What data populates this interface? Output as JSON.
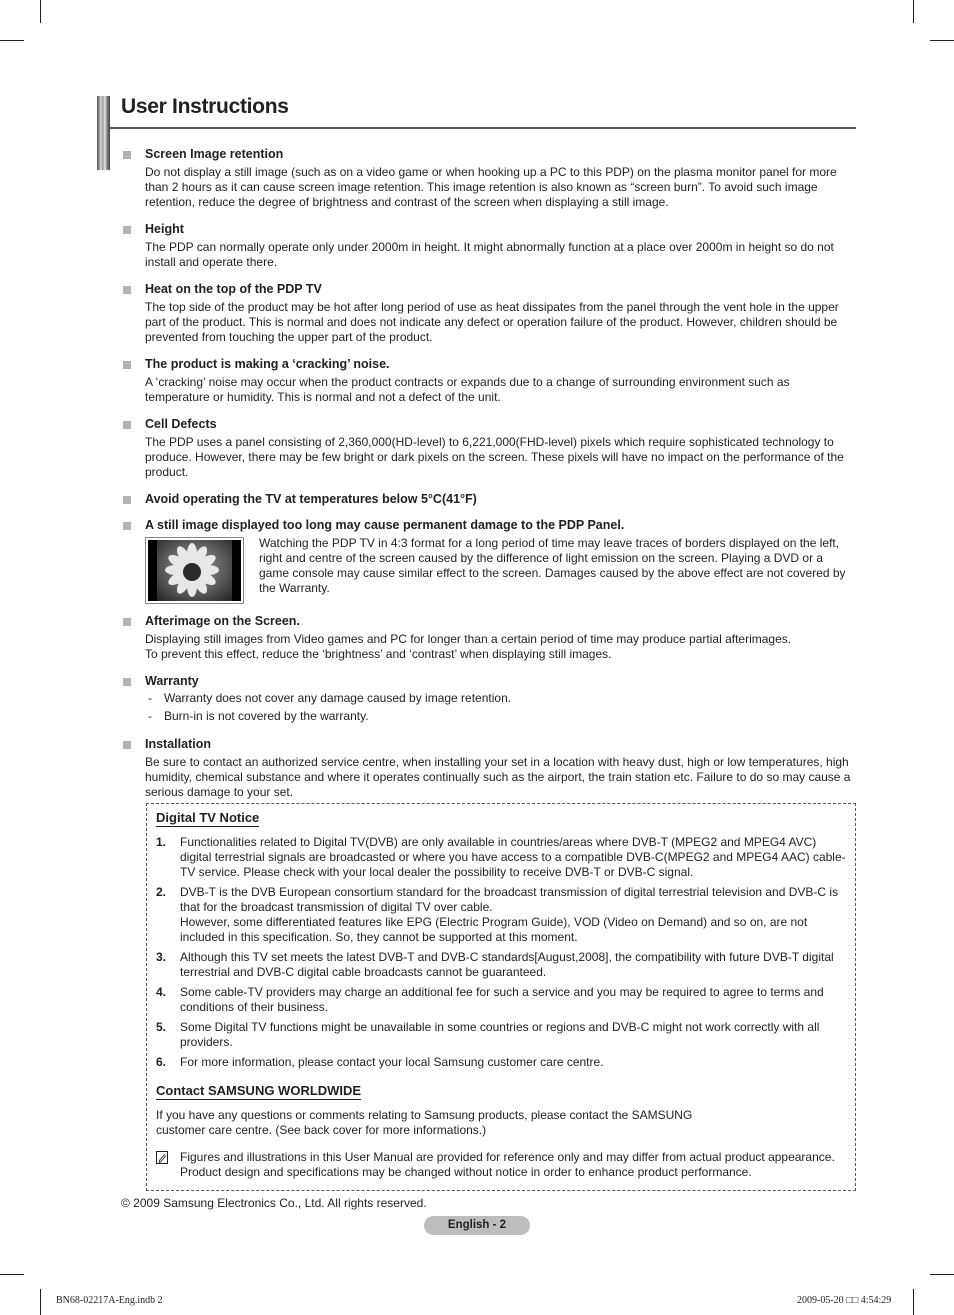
{
  "header": {
    "title": "User Instructions"
  },
  "sections": [
    {
      "title": "Screen Image retention",
      "body": "Do not display a still image (such as on a video game or when hooking up a PC to this PDP) on the plasma monitor panel for more than 2 hours as it can cause screen image retention. This image retention is also known as “screen burn”. To avoid such image retention, reduce the degree of brightness and contrast of the screen when displaying a still image."
    },
    {
      "title": "Height",
      "body": "The PDP can normally operate only under 2000m in height. It might abnormally function at a place over 2000m in height so do not install and operate there."
    },
    {
      "title": "Heat on the top of the PDP TV",
      "body": "The top side of the product may be hot after long period of use as heat dissipates from the panel through the vent hole in the upper part of the product. This is normal and does not indicate any defect or operation failure of the product. However, children should be prevented from touching the upper part of the product."
    },
    {
      "title": "The product is making a ‘cracking’ noise.",
      "body": "A ‘cracking’ noise may occur when the product contracts or expands due to a change of surrounding environment such as temperature or humidity. This is normal and not a defect of the unit."
    },
    {
      "title": "Cell Defects",
      "body": "The PDP uses a panel consisting of 2,360,000(HD-level) to 6,221,000(FHD-level) pixels which require sophisticated technology to produce. However, there may be few bright or dark pixels on the screen. These pixels will have no impact on the performance of the product."
    },
    {
      "title": "Avoid operating the TV at temperatures below 5°C(41°F)"
    },
    {
      "title": "A still image displayed too long may cause permanent damage to the PDP Panel.",
      "image_alt": "sunflower-image-with-side-borders",
      "body": "Watching the PDP TV in 4:3 format for a long period of time may leave traces of borders displayed on the left, right and centre of the screen caused by the difference of light emission on the screen. Playing a DVD or a game console may cause similar effect to the screen. Damages caused by the above effect are not covered by the Warranty."
    },
    {
      "title": "Afterimage on the Screen.",
      "body_lines": [
        "Displaying still images from Video games and PC for longer than a certain period of time may produce partial afterimages.",
        "To prevent this effect, reduce the ‘brightness’ and ‘contrast’ when displaying still images."
      ]
    },
    {
      "title": "Warranty",
      "items": [
        "Warranty does not cover any damage caused by image retention.",
        "Burn-in is not covered by the warranty."
      ]
    },
    {
      "title": "Installation",
      "body": "Be sure to contact an authorized service centre, when installing your set in a location with heavy dust, high or low temperatures, high humidity, chemical substance and where it operates continually such as the airport, the train station etc. Failure to do so may cause a serious damage to your set."
    }
  ],
  "notice": {
    "title": "Digital TV Notice",
    "items": [
      {
        "num": "1.",
        "text": "Functionalities related to Digital TV(DVB) are only available in countries/areas where DVB-T (MPEG2 and MPEG4 AVC) digital terrestrial signals are broadcasted or where you have access to a compatible DVB-C(MPEG2 and MPEG4 AAC) cable-TV service. Please check with your local dealer the possibility to receive DVB-T or DVB-C signal."
      },
      {
        "num": "2.",
        "text": "DVB-T is the DVB European consortium standard for the broadcast transmission of digital terrestrial television and DVB-C is that for the broadcast transmission of digital TV over cable.",
        "text2": "However, some differentiated features like EPG (Electric Program Guide), VOD (Video on Demand) and so on, are not included in this specification. So, they cannot be supported at this moment."
      },
      {
        "num": "3.",
        "text": "Although this TV set meets the latest DVB-T and DVB-C standards[August,2008], the compatibility with future DVB-T digital terrestrial and DVB-C digital cable broadcasts cannot be guaranteed."
      },
      {
        "num": "4.",
        "text": "Some cable-TV providers may charge an additional fee for such a service and you may be required to agree to terms and conditions of their business."
      },
      {
        "num": "5.",
        "text": "Some Digital TV functions might be unavailable in some countries or regions and DVB-C might not work correctly with all providers."
      },
      {
        "num": "6.",
        "text": "For more information, please contact your local Samsung customer care centre."
      }
    ],
    "contact_title": "Contact SAMSUNG WORLDWIDE",
    "contact_line1": "If you have any questions or comments relating to Samsung products, please contact the SAMSUNG",
    "contact_line2": "customer care centre. (See back cover for more informations.)",
    "note": "Figures and illustrations in this User Manual are provided for reference only and may differ from actual product appearance. Product design and specifications may be changed without notice in order to enhance product performance."
  },
  "footer": {
    "copyright": "© 2009 Samsung Electronics Co., Ltd. All rights reserved.",
    "page_label": "English - 2",
    "slug_left": "BN68-02217A-Eng.indb   2",
    "slug_right": "2009-05-20   □□ 4:54:29"
  }
}
